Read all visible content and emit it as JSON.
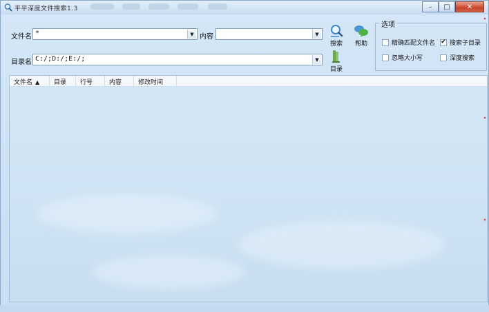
{
  "window": {
    "title": "平平深度文件搜索1.3",
    "controls": {
      "minimize": "–",
      "maximize": "□",
      "close": "✕"
    }
  },
  "search": {
    "filename_label": "文件名",
    "filename_value": "*",
    "content_label": "内容",
    "content_value": "",
    "directory_label": "目录名",
    "directory_value": "C:/;D:/;E:/;"
  },
  "toolbar": {
    "search_label": "搜索",
    "help_label": "帮助",
    "directory_label": "目录"
  },
  "options": {
    "title": "选项",
    "items": [
      {
        "label": "精确匹配文件名",
        "checked": false
      },
      {
        "label": "搜索子目录",
        "checked": true
      },
      {
        "label": "忽略大小写",
        "checked": false
      },
      {
        "label": "深度搜索",
        "checked": false
      }
    ],
    "checkmark": "✔"
  },
  "results": {
    "columns": [
      "文件名",
      "目录",
      "行号",
      "内容",
      "修改时间"
    ],
    "sort_indicator": "▲",
    "rows": []
  },
  "icons": {
    "app": "magnifier-icon",
    "search": "search-icon",
    "help": "help-icon",
    "directory": "folder-icon"
  },
  "colors": {
    "background": "#cfe3f5",
    "border": "#7f9db9",
    "close": "#c8452a"
  }
}
